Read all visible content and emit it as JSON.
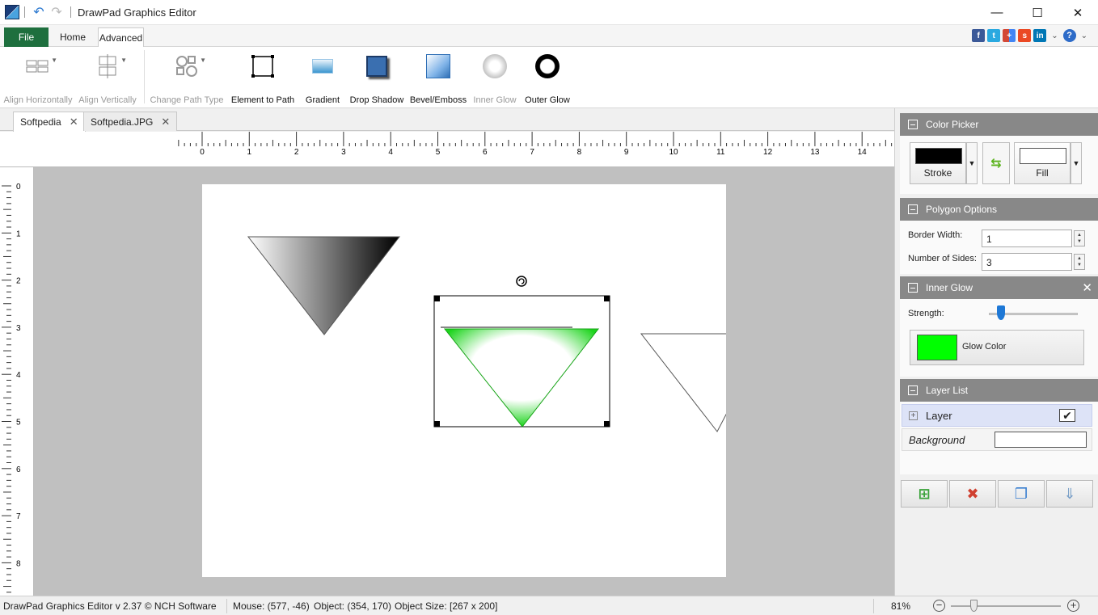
{
  "window": {
    "title": "DrawPad Graphics Editor"
  },
  "menu": {
    "file": "File",
    "home": "Home",
    "advanced": "Advanced"
  },
  "ribbon": {
    "items": [
      {
        "label": "Align Horizontally",
        "enabled": false
      },
      {
        "label": "Align Vertically",
        "enabled": false
      },
      {
        "label": "Change Path Type",
        "enabled": false
      },
      {
        "label": "Element to Path",
        "enabled": true
      },
      {
        "label": "Gradient",
        "enabled": true
      },
      {
        "label": "Drop Shadow",
        "enabled": true
      },
      {
        "label": "Bevel/Emboss",
        "enabled": true
      },
      {
        "label": "Inner Glow",
        "enabled": false
      },
      {
        "label": "Outer Glow",
        "enabled": true
      }
    ]
  },
  "doc_tabs": [
    {
      "label": "Softpedia",
      "active": true
    },
    {
      "label": "Softpedia.JPG",
      "active": false
    }
  ],
  "ruler": {
    "h_labels": [
      "0",
      "1",
      "2",
      "3",
      "4",
      "5",
      "6",
      "7",
      "8",
      "9",
      "10",
      "11",
      "12",
      "13",
      "14"
    ],
    "v_labels": [
      "0",
      "1",
      "2",
      "3",
      "4",
      "5",
      "6",
      "7",
      "8"
    ]
  },
  "panels": {
    "color_picker": {
      "title": "Color Picker",
      "stroke_label": "Stroke",
      "fill_label": "Fill",
      "stroke_color": "#000000",
      "fill_color": "#ffffff"
    },
    "polygon_options": {
      "title": "Polygon Options",
      "border_width_label": "Border Width:",
      "border_width": "1",
      "sides_label": "Number of Sides:",
      "sides": "3"
    },
    "inner_glow": {
      "title": "Inner Glow",
      "strength_label": "Strength:",
      "strength": 0.14,
      "glow_color_label": "Glow Color",
      "glow_color": "#00ff00"
    },
    "layer_list": {
      "title": "Layer List",
      "layer_name": "Layer",
      "background_name": "Background"
    }
  },
  "status": {
    "version": "DrawPad Graphics Editor v 2.37 © NCH Software",
    "mouse": "Mouse: (577, -46)",
    "object": "Object: (354, 170)",
    "size": "Object Size: [267 x 200]",
    "zoom": "81%"
  },
  "colors": {
    "file_tab": "#1e6f3e",
    "panel_header": "#888888",
    "accent": "#1e78d6"
  }
}
